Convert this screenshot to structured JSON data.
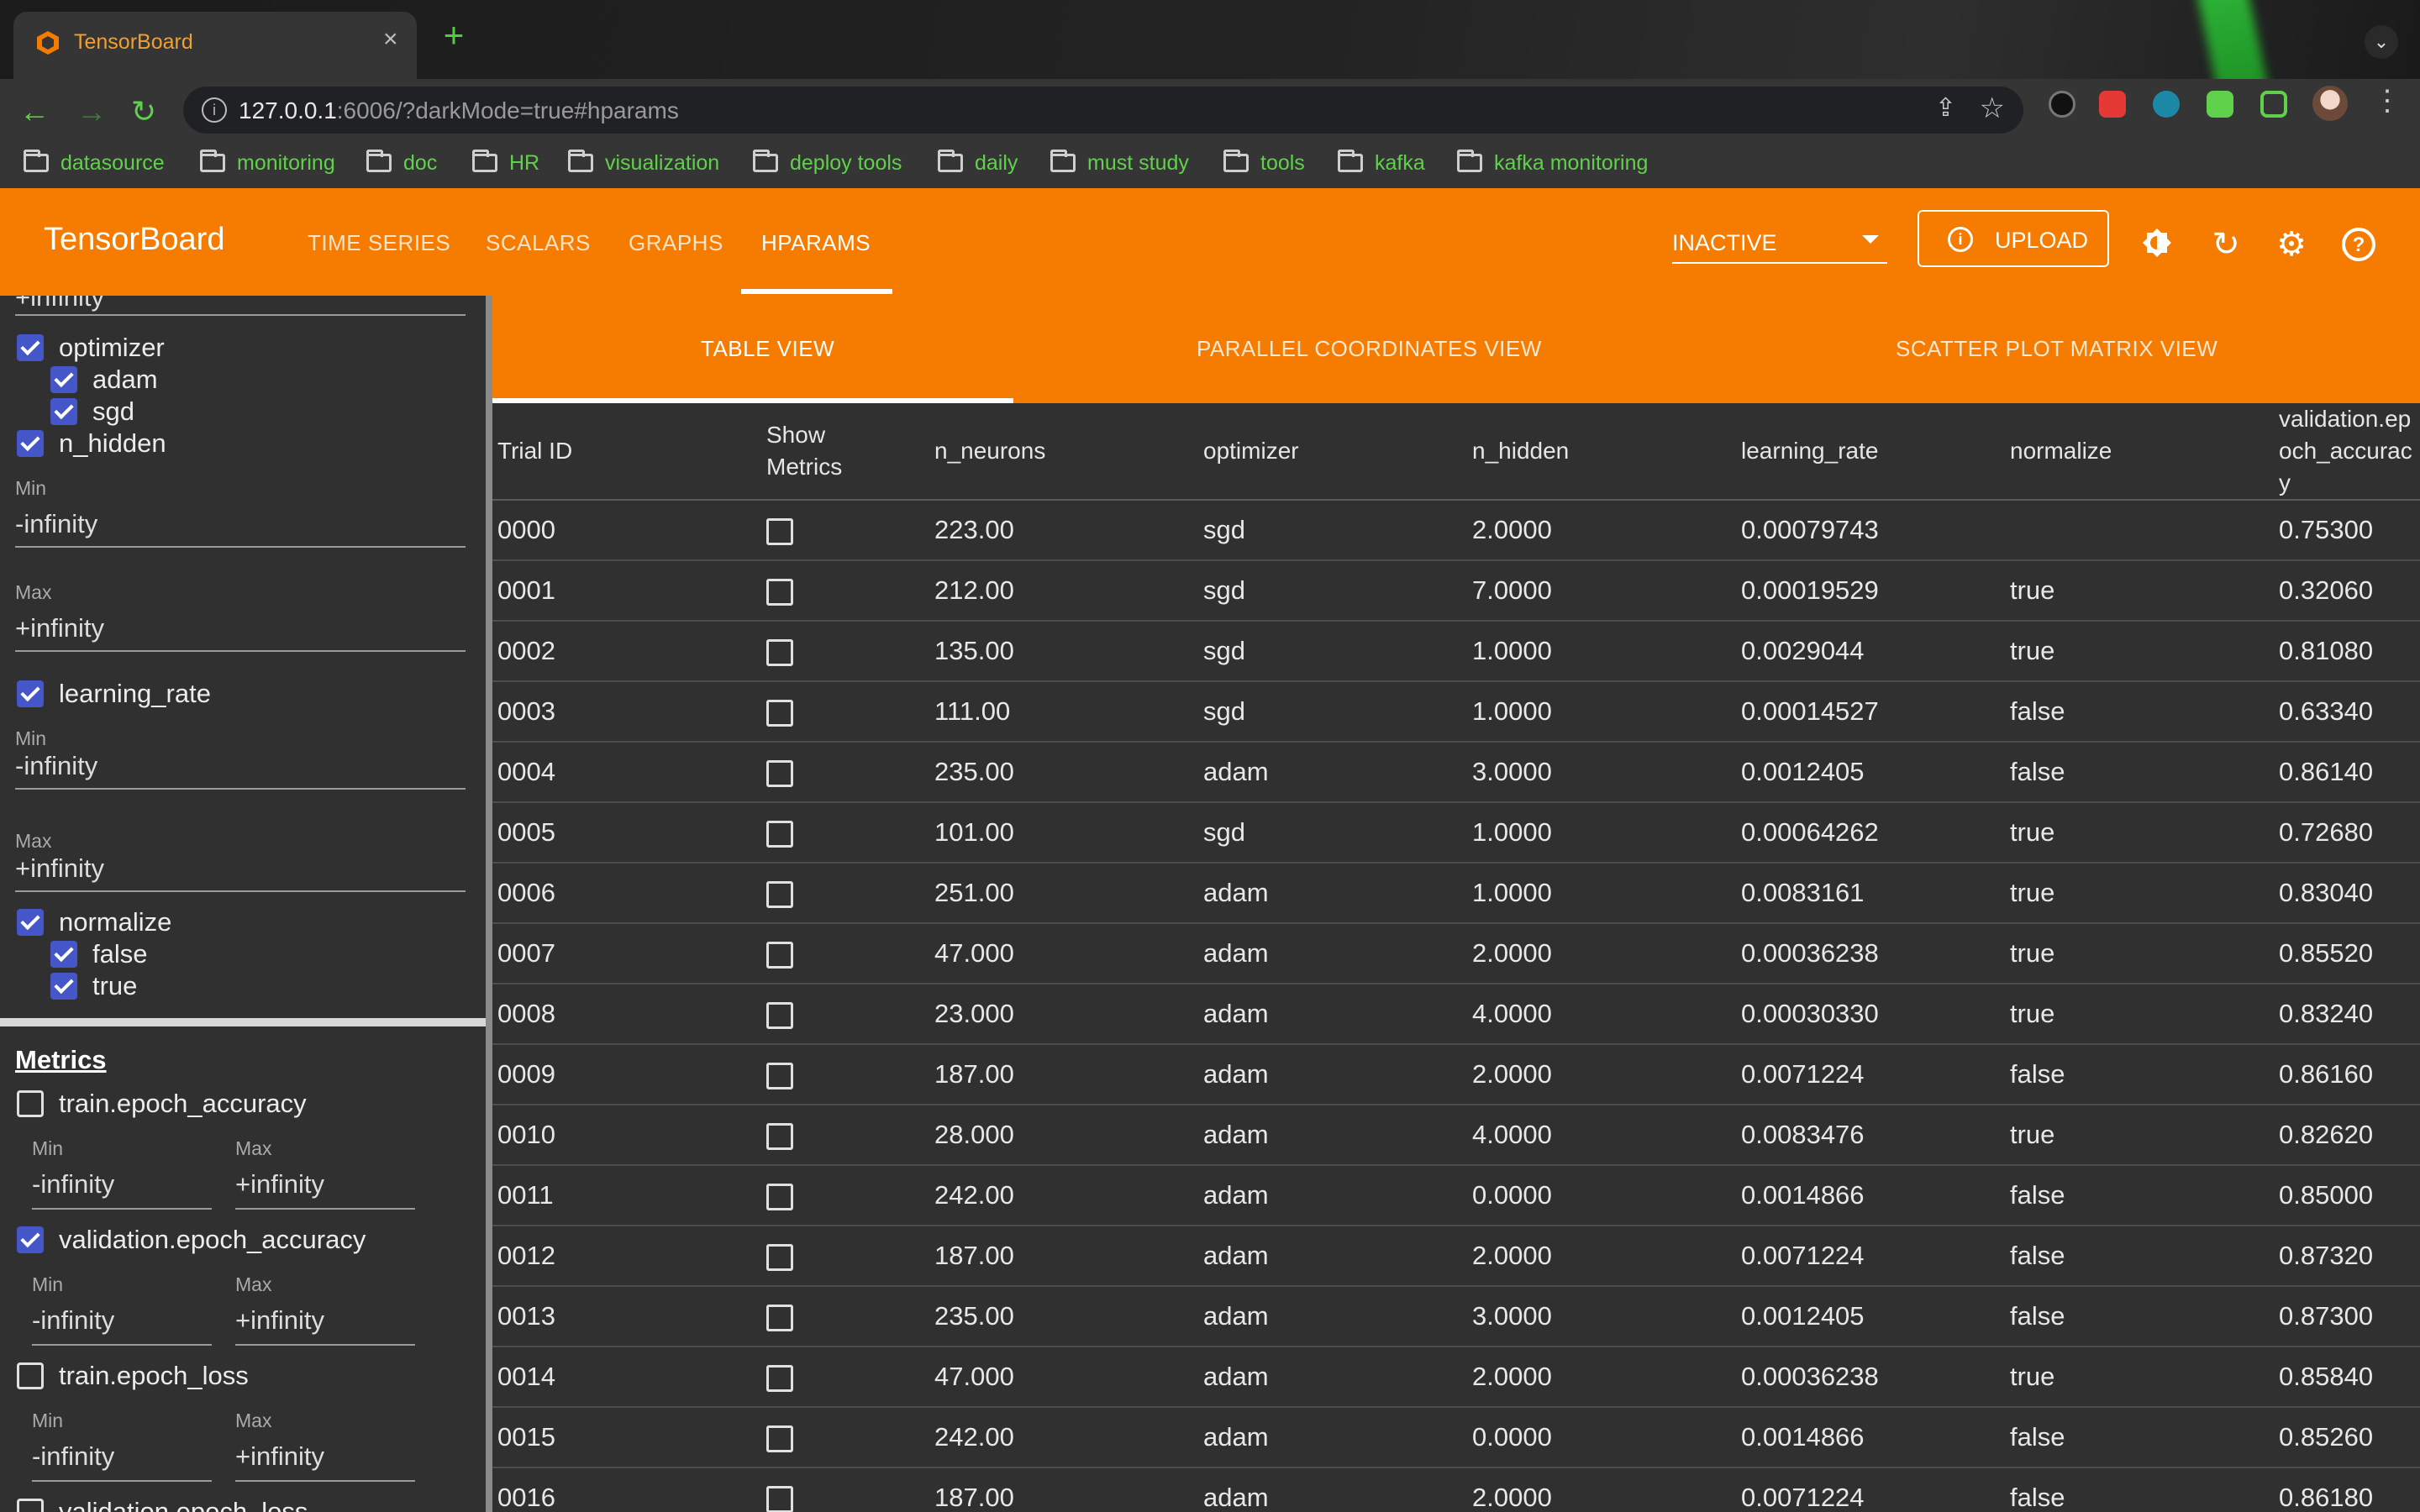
{
  "browser": {
    "tab_title": "TensorBoard",
    "url_host": "127.0.0.1",
    "url_rest": ":6006/?darkMode=true#hparams",
    "bookmarks": [
      "datasource",
      "monitoring",
      "doc",
      "HR",
      "visualization",
      "deploy tools",
      "daily",
      "must study",
      "tools",
      "kafka",
      "kafka monitoring"
    ]
  },
  "header": {
    "brand": "TensorBoard",
    "nav": [
      "TIME SERIES",
      "SCALARS",
      "GRAPHS",
      "HPARAMS"
    ],
    "active_nav": "HPARAMS",
    "run_state": "INACTIVE",
    "upload_label": "UPLOAD"
  },
  "sidebar": {
    "top_partial_value": "+infinity",
    "optimizer": {
      "label": "optimizer",
      "checked": true,
      "options": [
        {
          "label": "adam",
          "checked": true
        },
        {
          "label": "sgd",
          "checked": true
        }
      ]
    },
    "n_hidden": {
      "label": "n_hidden",
      "checked": true,
      "min_label": "Min",
      "min": "-infinity",
      "max_label": "Max",
      "max": "+infinity"
    },
    "learning_rate": {
      "label": "learning_rate",
      "checked": true,
      "min_label": "Min",
      "min": "-infinity",
      "max_label": "Max",
      "max": "+infinity"
    },
    "normalize": {
      "label": "normalize",
      "checked": true,
      "options": [
        {
          "label": "false",
          "checked": true
        },
        {
          "label": "true",
          "checked": true
        }
      ]
    },
    "metrics_title": "Metrics",
    "metrics": [
      {
        "label": "train.epoch_accuracy",
        "checked": false,
        "min_label": "Min",
        "min": "-infinity",
        "max_label": "Max",
        "max": "+infinity"
      },
      {
        "label": "validation.epoch_accuracy",
        "checked": true,
        "min_label": "Min",
        "min": "-infinity",
        "max_label": "Max",
        "max": "+infinity"
      },
      {
        "label": "train.epoch_loss",
        "checked": false,
        "min_label": "Min",
        "min": "-infinity",
        "max_label": "Max",
        "max": "+infinity"
      },
      {
        "label": "validation.epoch_loss",
        "checked": false
      }
    ]
  },
  "view_tabs": [
    "TABLE VIEW",
    "PARALLEL COORDINATES VIEW",
    "SCATTER PLOT MATRIX VIEW"
  ],
  "table": {
    "columns": [
      "Trial ID",
      "Show Metrics",
      "n_neurons",
      "optimizer",
      "n_hidden",
      "learning_rate",
      "normalize",
      "validation.epoch_accuracy"
    ],
    "rows": [
      [
        "0000",
        "",
        "223.00",
        "sgd",
        "2.0000",
        "0.00079743",
        "",
        "0.75300"
      ],
      [
        "0001",
        "",
        "212.00",
        "sgd",
        "7.0000",
        "0.00019529",
        "true",
        "0.32060"
      ],
      [
        "0002",
        "",
        "135.00",
        "sgd",
        "1.0000",
        "0.0029044",
        "true",
        "0.81080"
      ],
      [
        "0003",
        "",
        "111.00",
        "sgd",
        "1.0000",
        "0.00014527",
        "false",
        "0.63340"
      ],
      [
        "0004",
        "",
        "235.00",
        "adam",
        "3.0000",
        "0.0012405",
        "false",
        "0.86140"
      ],
      [
        "0005",
        "",
        "101.00",
        "sgd",
        "1.0000",
        "0.00064262",
        "true",
        "0.72680"
      ],
      [
        "0006",
        "",
        "251.00",
        "adam",
        "1.0000",
        "0.0083161",
        "true",
        "0.83040"
      ],
      [
        "0007",
        "",
        "47.000",
        "adam",
        "2.0000",
        "0.00036238",
        "true",
        "0.85520"
      ],
      [
        "0008",
        "",
        "23.000",
        "adam",
        "4.0000",
        "0.00030330",
        "true",
        "0.83240"
      ],
      [
        "0009",
        "",
        "187.00",
        "adam",
        "2.0000",
        "0.0071224",
        "false",
        "0.86160"
      ],
      [
        "0010",
        "",
        "28.000",
        "adam",
        "4.0000",
        "0.0083476",
        "true",
        "0.82620"
      ],
      [
        "0011",
        "",
        "242.00",
        "adam",
        "0.0000",
        "0.0014866",
        "false",
        "0.85000"
      ],
      [
        "0012",
        "",
        "187.00",
        "adam",
        "2.0000",
        "0.0071224",
        "false",
        "0.87320"
      ],
      [
        "0013",
        "",
        "235.00",
        "adam",
        "3.0000",
        "0.0012405",
        "false",
        "0.87300"
      ],
      [
        "0014",
        "",
        "47.000",
        "adam",
        "2.0000",
        "0.00036238",
        "true",
        "0.85840"
      ],
      [
        "0015",
        "",
        "242.00",
        "adam",
        "0.0000",
        "0.0014866",
        "false",
        "0.85260"
      ],
      [
        "0016",
        "",
        "187.00",
        "adam",
        "2.0000",
        "0.0071224",
        "false",
        "0.86180"
      ]
    ]
  },
  "colors": {
    "accent": "#f57c00",
    "checkbox": "#4556c9",
    "link": "#5fd14a"
  }
}
